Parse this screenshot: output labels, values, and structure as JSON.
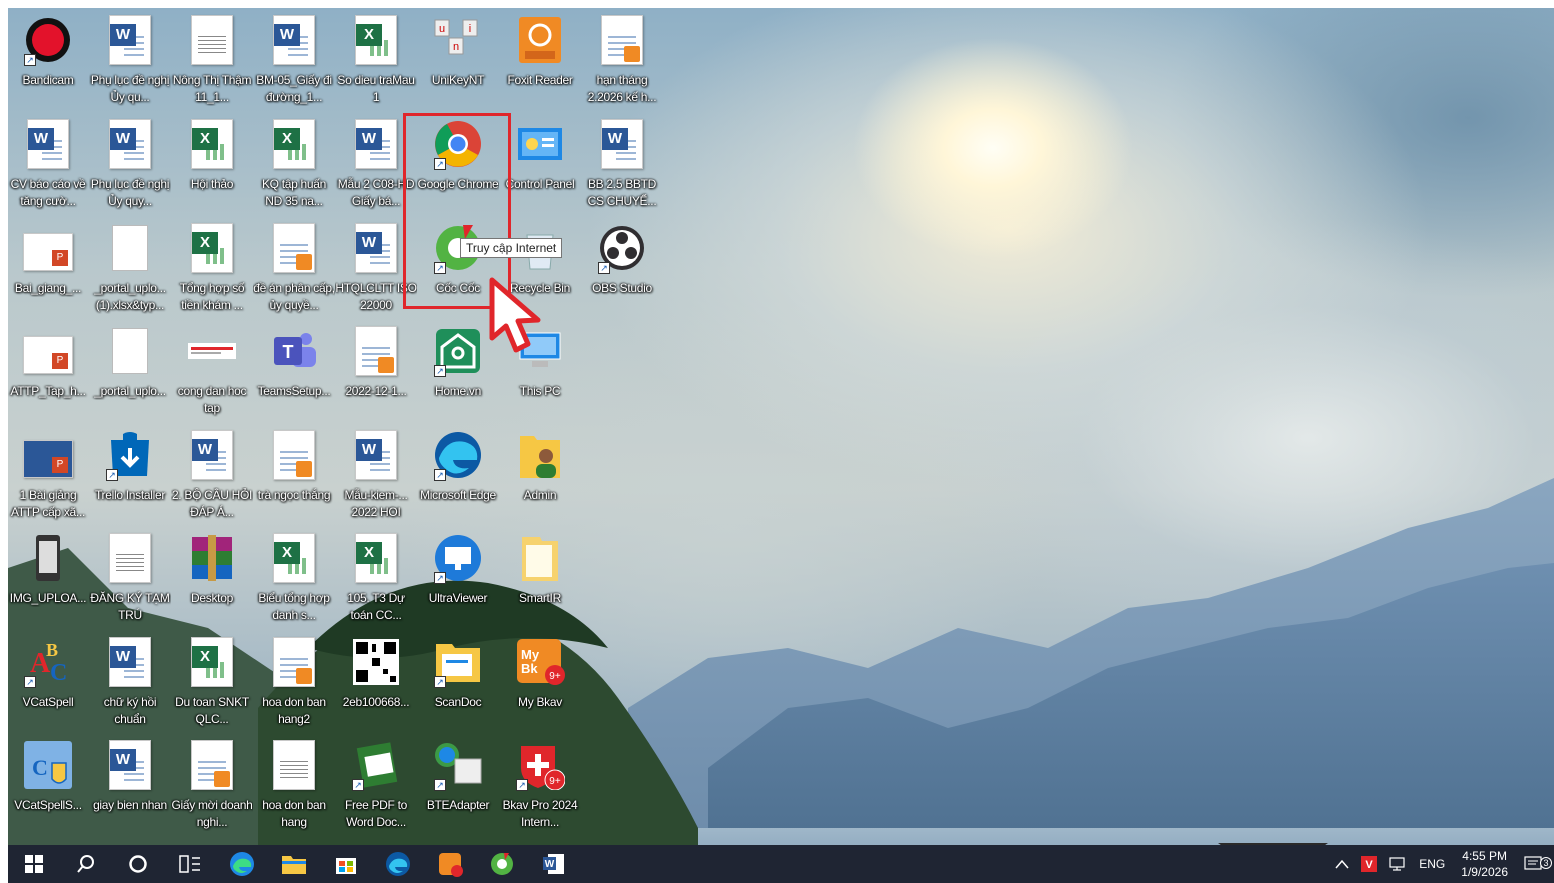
{
  "desktop": {
    "icons": [
      {
        "label": "Bandicam",
        "icon": "bandicam-icon",
        "kind": "bandicam"
      },
      {
        "label": "Phụ lục đề nghị Ủy qu...",
        "icon": "word-doc-icon",
        "kind": "word"
      },
      {
        "label": "Nông Thị Thậm 11_1...",
        "icon": "image-doc-icon",
        "kind": "scan"
      },
      {
        "label": "BM-05_Giấy đi đường_1...",
        "icon": "word-doc-icon",
        "kind": "word"
      },
      {
        "label": "So dieu traMau 1",
        "icon": "excel-doc-icon",
        "kind": "excel"
      },
      {
        "label": "UniKeyNT",
        "icon": "unikey-icon",
        "kind": "unikey"
      },
      {
        "label": "Foxit Reader",
        "icon": "foxit-icon",
        "kind": "foxit"
      },
      {
        "label": "hạn tháng 2.2026 kế h...",
        "icon": "pdf-doc-icon",
        "kind": "pdfdoc"
      },
      {
        "label": "CV báo cáo về tăng cườ...",
        "icon": "word-doc-icon",
        "kind": "word"
      },
      {
        "label": "Phụ lục đề nghị Ủy quy...",
        "icon": "word-doc-icon",
        "kind": "word"
      },
      {
        "label": "Hội thảo",
        "icon": "excel-doc-icon",
        "kind": "excel"
      },
      {
        "label": "KQ tập huấn ND 35 na...",
        "icon": "excel-doc-icon",
        "kind": "excel"
      },
      {
        "label": "Mẫu 2 C08-HD Giấy bá...",
        "icon": "word-doc-icon",
        "kind": "word"
      },
      {
        "label": "Google Chrome",
        "icon": "chrome-icon",
        "kind": "chrome"
      },
      {
        "label": "Control Panel",
        "icon": "control-panel-icon",
        "kind": "control"
      },
      {
        "label": "BB 2.5 BBTD CS CHUYỂ...",
        "icon": "word-doc-icon",
        "kind": "word"
      },
      {
        "label": "Bai_giang_...",
        "icon": "ppt-doc-icon",
        "kind": "ppt"
      },
      {
        "label": "_portal_uplo... (1).xlsx&typ...",
        "icon": "blank-file-icon",
        "kind": "blank"
      },
      {
        "label": "Tổng hợp số tiền khám ...",
        "icon": "excel-doc-icon",
        "kind": "excel"
      },
      {
        "label": "đề án phân cấp, ủy quyề...",
        "icon": "pdf-doc-icon",
        "kind": "pdfdoc"
      },
      {
        "label": "HTQLCLTT ISO 22000",
        "icon": "word-doc-icon",
        "kind": "word"
      },
      {
        "label": "Cốc Cốc",
        "icon": "coccoc-icon",
        "kind": "coccoc"
      },
      {
        "label": "Recycle Bin",
        "icon": "recycle-bin-icon",
        "kind": "recycle"
      },
      {
        "label": "OBS Studio",
        "icon": "obs-icon",
        "kind": "obs"
      },
      {
        "label": "ATTP_Tap_h...",
        "icon": "ppt-doc-icon",
        "kind": "ppt"
      },
      {
        "label": "_portal_uplo...",
        "icon": "blank-file-icon",
        "kind": "blank"
      },
      {
        "label": "cong dan hoc tap",
        "icon": "image-strip-icon",
        "kind": "strip"
      },
      {
        "label": "TeamsSetup...",
        "icon": "teams-icon",
        "kind": "teams"
      },
      {
        "label": "2022-12-1...",
        "icon": "pdf-doc-icon",
        "kind": "pdfdoc"
      },
      {
        "label": "Home.vn",
        "icon": "homevn-icon",
        "kind": "homevn"
      },
      {
        "label": "This PC",
        "icon": "this-pc-icon",
        "kind": "thispc"
      },
      {
        "label": "",
        "icon": "",
        "kind": "empty"
      },
      {
        "label": "1 Bài giảng ATTP cấp xã...",
        "icon": "ppt-doc-icon",
        "kind": "pptimg"
      },
      {
        "label": "Trello Installer",
        "icon": "trello-icon",
        "kind": "trello"
      },
      {
        "label": "2. BỘ CÂU HỎI ĐÁP Á...",
        "icon": "word-doc-icon",
        "kind": "word"
      },
      {
        "label": "trà ngọc thắng",
        "icon": "pdf-doc-icon",
        "kind": "pdfimg"
      },
      {
        "label": "Mẫu-kiem-... 2022 HOI",
        "icon": "word-doc-icon",
        "kind": "word"
      },
      {
        "label": "Microsoft Edge",
        "icon": "edge-icon",
        "kind": "edge"
      },
      {
        "label": "Admin",
        "icon": "user-folder-icon",
        "kind": "admin"
      },
      {
        "label": "",
        "icon": "",
        "kind": "empty"
      },
      {
        "label": "IMG_UPLOA...",
        "icon": "phone-image-icon",
        "kind": "phone"
      },
      {
        "label": "ĐĂNG KÝ TẠM TRÚ",
        "icon": "scan-doc-icon",
        "kind": "scan"
      },
      {
        "label": "Desktop",
        "icon": "winrar-icon",
        "kind": "winrar"
      },
      {
        "label": "Biểu tổng hợp danh s...",
        "icon": "excel-doc-icon",
        "kind": "excel"
      },
      {
        "label": "105. T3 Dự toán CC...",
        "icon": "excel-doc-icon",
        "kind": "excel"
      },
      {
        "label": "UltraViewer",
        "icon": "ultraviewer-icon",
        "kind": "ultra"
      },
      {
        "label": "SmartIR",
        "icon": "folder-icon",
        "kind": "folder"
      },
      {
        "label": "",
        "icon": "",
        "kind": "empty"
      },
      {
        "label": "VCatSpell",
        "icon": "vcatspell-icon",
        "kind": "abc"
      },
      {
        "label": "chữ ký hồi chuẩn",
        "icon": "word-doc-icon",
        "kind": "word"
      },
      {
        "label": "Du toan SNKT QLC...",
        "icon": "excel-doc-icon",
        "kind": "excel"
      },
      {
        "label": "hoa don ban hang2",
        "icon": "pdf-doc-icon",
        "kind": "pdfimg"
      },
      {
        "label": "2eb100668...",
        "icon": "qr-code-icon",
        "kind": "qr"
      },
      {
        "label": "ScanDoc",
        "icon": "scandoc-icon",
        "kind": "scandoc"
      },
      {
        "label": "My Bkav",
        "icon": "mybkav-icon",
        "kind": "mybkav"
      },
      {
        "label": "",
        "icon": "",
        "kind": "empty"
      },
      {
        "label": "VCatSpellS...",
        "icon": "vcatspell-setup-icon",
        "kind": "setup"
      },
      {
        "label": "giay bien nhan",
        "icon": "word-doc-icon",
        "kind": "word"
      },
      {
        "label": "Giấy mời doanh nghi...",
        "icon": "pdf-doc-icon",
        "kind": "pdfdoc"
      },
      {
        "label": "hoa don ban hang",
        "icon": "image-doc-icon",
        "kind": "scan"
      },
      {
        "label": "Free PDF to Word Doc...",
        "icon": "pdf-to-word-icon",
        "kind": "pdf2word"
      },
      {
        "label": "BTEAdapter",
        "icon": "bluetooth-adapter-icon",
        "kind": "bte"
      },
      {
        "label": "Bkav Pro 2024 Intern...",
        "icon": "bkav-pro-icon",
        "kind": "bkavpro"
      },
      {
        "label": "",
        "icon": "",
        "kind": "empty"
      }
    ]
  },
  "tooltip": {
    "text": "Truy cập Internet"
  },
  "taskbar": {
    "buttons": [
      {
        "name": "start",
        "icon": "windows-start-icon"
      },
      {
        "name": "search",
        "icon": "search-icon"
      },
      {
        "name": "cortana",
        "icon": "cortana-circle-icon"
      },
      {
        "name": "task-view",
        "icon": "task-view-icon"
      },
      {
        "name": "edge",
        "icon": "edge-icon"
      },
      {
        "name": "file-explorer",
        "icon": "folder-icon"
      },
      {
        "name": "store",
        "icon": "store-icon"
      },
      {
        "name": "edge-2",
        "icon": "edge-icon"
      },
      {
        "name": "mybkav",
        "icon": "mybkav-icon"
      },
      {
        "name": "coccoc",
        "icon": "coccoc-icon"
      },
      {
        "name": "word",
        "icon": "word-icon"
      }
    ],
    "tray": {
      "language": "ENG",
      "time": "4:55 PM",
      "date": "1/9/2026",
      "notification_count": "3"
    }
  }
}
